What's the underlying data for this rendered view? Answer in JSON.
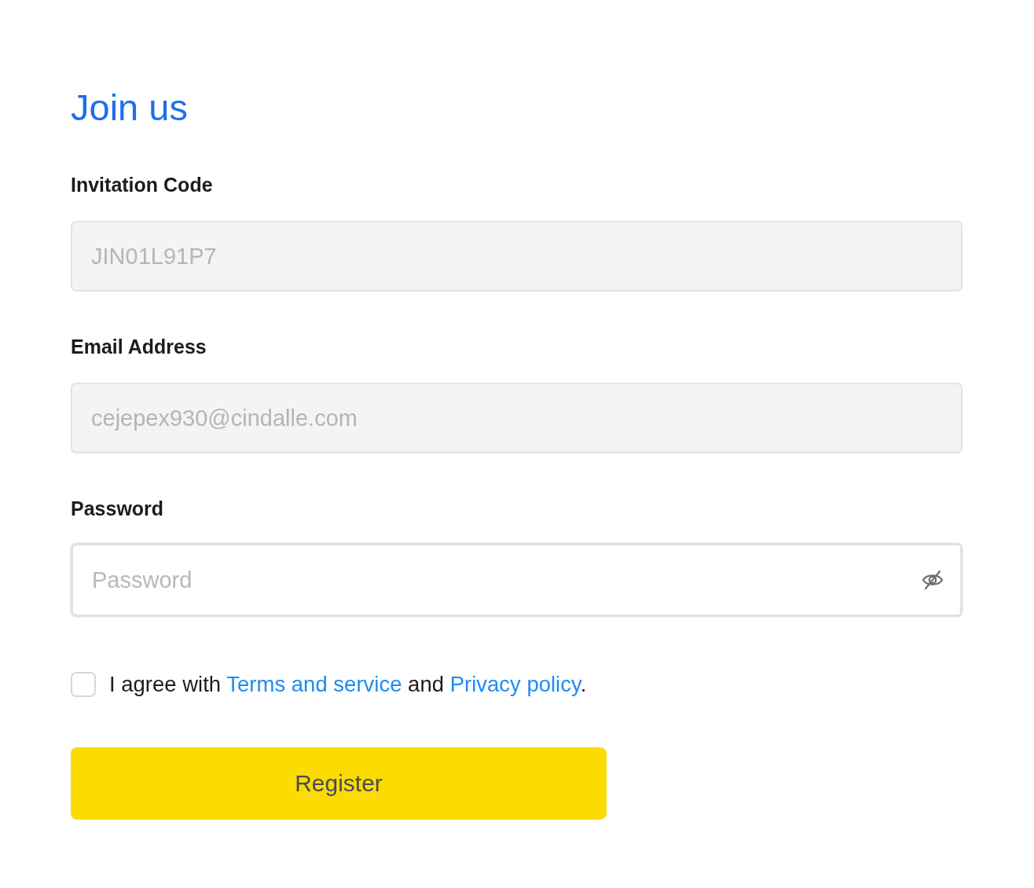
{
  "title": "Join us",
  "fields": [
    {
      "kind": "text",
      "label": "Invitation Code",
      "value": "JIN01L91P7",
      "disabled": true
    },
    {
      "kind": "text",
      "label": "Email Address",
      "value": "cejepex930@cindalle.com",
      "disabled": true
    },
    {
      "kind": "password",
      "label": "Password",
      "placeholder": "Password",
      "disabled": false
    }
  ],
  "agreement": {
    "checked": false,
    "parts": [
      {
        "kind": "text",
        "text": "I agree with "
      },
      {
        "kind": "link",
        "text": "Terms and service"
      },
      {
        "kind": "text",
        "text": " and "
      },
      {
        "kind": "link",
        "text": "Privacy policy"
      },
      {
        "kind": "text",
        "text": "."
      }
    ]
  },
  "button": {
    "label": "Register"
  }
}
